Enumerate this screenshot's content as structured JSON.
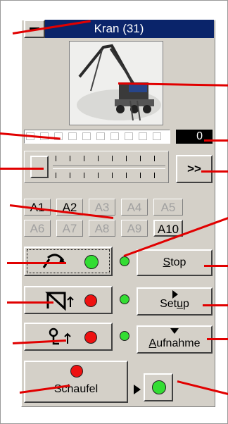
{
  "window": {
    "title": "Kran (31)",
    "minimize_icon": "minimize-icon"
  },
  "counter": {
    "value": "0"
  },
  "progress": {
    "segments": 10,
    "filled": 0
  },
  "slider": {
    "position": 0
  },
  "forward_button": {
    "label": ">>"
  },
  "accessory_buttons": [
    {
      "label": "A1",
      "enabled": true
    },
    {
      "label": "A2",
      "enabled": true
    },
    {
      "label": "A3",
      "enabled": false
    },
    {
      "label": "A4",
      "enabled": false
    },
    {
      "label": "A5",
      "enabled": false
    },
    {
      "label": "A6",
      "enabled": false
    },
    {
      "label": "A7",
      "enabled": false
    },
    {
      "label": "A8",
      "enabled": false
    },
    {
      "label": "A9",
      "enabled": false
    },
    {
      "label": "A10",
      "enabled": true
    }
  ],
  "controls": {
    "stop": {
      "label": "Stop",
      "mnemonic": "S",
      "rest": "top"
    },
    "setup": {
      "label": "Setup",
      "pre": "Set",
      "mnemonic": "u",
      "post": "p"
    },
    "aufnahme": {
      "label": "Aufnahme",
      "mnemonic": "A",
      "rest": "ufnahme"
    },
    "schaufel": {
      "label": "Schaufel"
    }
  },
  "colors": {
    "led_green": "#33dd33",
    "led_red": "#ee1111",
    "title_bg": "#0a246a",
    "annotation_line": "#e10000"
  }
}
